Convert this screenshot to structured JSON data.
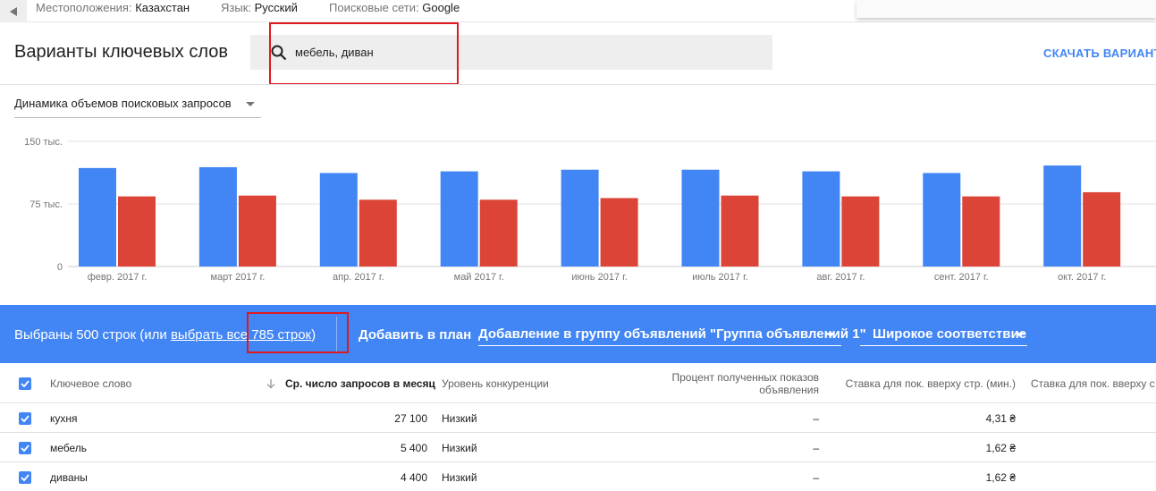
{
  "topbar": {
    "filters": [
      {
        "label": "Местоположения:",
        "value": "Казахстан"
      },
      {
        "label": "Язык:",
        "value": "Русский"
      },
      {
        "label": "Поисковые сети:",
        "value": "Google"
      }
    ]
  },
  "header": {
    "title": "Варианты ключевых слов",
    "search_value": "мебель, диван",
    "download_label": "СКАЧАТЬ ВАРИАНТ"
  },
  "chart_selector": {
    "label": "Динамика объемов поисковых запросов"
  },
  "chart_data": {
    "type": "bar",
    "categories": [
      "февр. 2017 г.",
      "март 2017 г.",
      "апр. 2017 г.",
      "май 2017 г.",
      "июнь 2017 г.",
      "июль 2017 г.",
      "авг. 2017 г.",
      "сент. 2017 г.",
      "окт. 2017 г."
    ],
    "series": [
      {
        "values": [
          118000,
          119000,
          112000,
          114000,
          116000,
          116000,
          114000,
          112000,
          121000
        ],
        "color": "#4285f4"
      },
      {
        "values": [
          84000,
          85000,
          80000,
          80000,
          82000,
          85000,
          84000,
          84000,
          89000
        ],
        "color": "#db4437"
      }
    ],
    "yticks": [
      {
        "value": 150000,
        "label": "150 тыс."
      },
      {
        "value": 75000,
        "label": "75 тыс."
      },
      {
        "value": 0,
        "label": "0"
      }
    ],
    "ylim": [
      0,
      150000
    ],
    "grid": true
  },
  "selection_bar": {
    "selected_text": "Выбраны 500 строк (или ",
    "select_all_link": "выбрать все 785 строк",
    "close_paren": ")",
    "add_to_plan": "Добавить в план",
    "ad_group_dropdown": "Добавление в группу объявлений \"Группа объявлений 1\"",
    "match_type_dropdown": "Широкое соответствие"
  },
  "table": {
    "headers": {
      "keyword": "Ключевое слово",
      "avg_searches": "Ср. число запросов в месяц",
      "competition": "Уровень конкуренции",
      "impression_share_line1": "Процент полученных показов",
      "impression_share_line2": "объявления",
      "bid_low": "Ставка для пок. вверху стр. (мин.)",
      "bid_high": "Ставка для пок. вверху с"
    },
    "rows": [
      {
        "keyword": "кухня",
        "avg_searches": "27 100",
        "competition": "Низкий",
        "impression_share": "–",
        "bid_low": "4,31 ₴"
      },
      {
        "keyword": "мебель",
        "avg_searches": "5 400",
        "competition": "Низкий",
        "impression_share": "–",
        "bid_low": "1,62 ₴"
      },
      {
        "keyword": "диваны",
        "avg_searches": "4 400",
        "competition": "Низкий",
        "impression_share": "–",
        "bid_low": "1,62 ₴"
      }
    ]
  }
}
